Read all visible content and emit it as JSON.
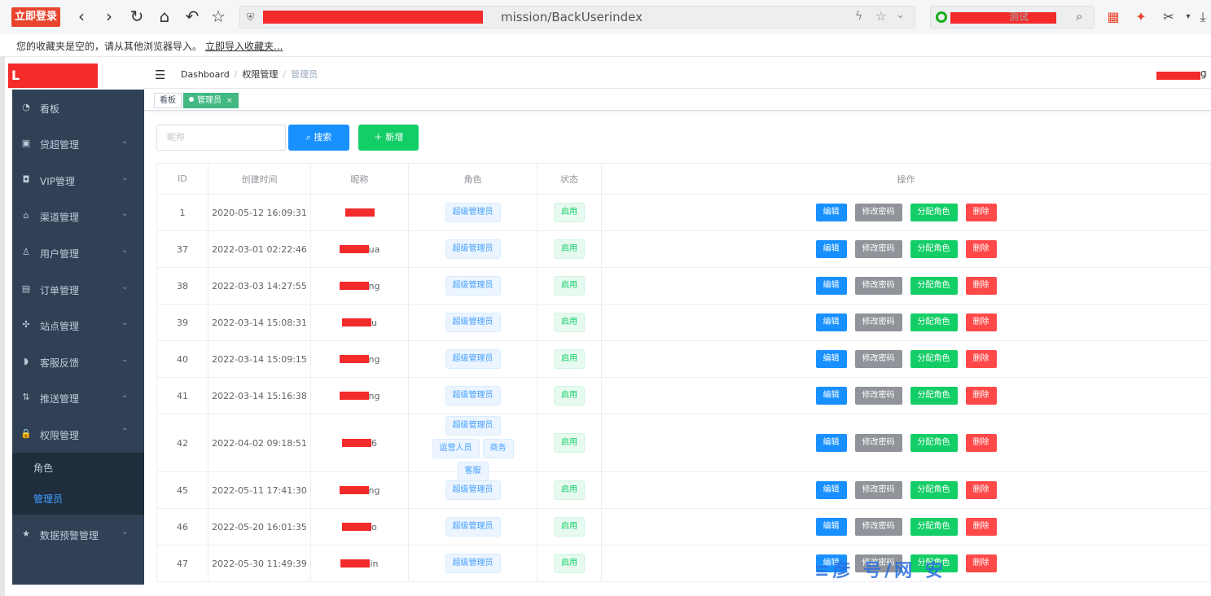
{
  "browser": {
    "login_label": "立即登录",
    "url_tail": "mission/BackUserindex",
    "search_tail": "测试",
    "fav_text": "您的收藏夹是空的，请从其他浏览器导入。",
    "fav_link": "立即导入收藏夹..."
  },
  "app": {
    "logo_text": "L",
    "breadcrumb": [
      "Dashboard",
      "权限管理",
      "管理员"
    ],
    "user_tail": "g"
  },
  "sidebar": {
    "items": [
      {
        "label": "看板",
        "icon": "dashboard-icon",
        "glyph": "◔"
      },
      {
        "label": "贷超管理",
        "icon": "wallet-icon",
        "glyph": "▣"
      },
      {
        "label": "VIP管理",
        "icon": "camera-icon",
        "glyph": "◘"
      },
      {
        "label": "渠道管理",
        "icon": "bell-icon",
        "glyph": "⌂"
      },
      {
        "label": "用户管理",
        "icon": "user-icon",
        "glyph": "♙"
      },
      {
        "label": "订单管理",
        "icon": "clipboard-icon",
        "glyph": "▤"
      },
      {
        "label": "站点管理",
        "icon": "site-icon",
        "glyph": "✣"
      },
      {
        "label": "客服反馈",
        "icon": "headset-icon",
        "glyph": "◗"
      },
      {
        "label": "推送管理",
        "icon": "sort-icon",
        "glyph": "⇅"
      },
      {
        "label": "权限管理",
        "icon": "lock-icon",
        "glyph": "🔒"
      }
    ],
    "sub_items": [
      "角色",
      "管理员"
    ],
    "last_item": {
      "label": "数据预警管理",
      "icon": "star-icon",
      "glyph": "★"
    }
  },
  "tags": [
    "看板",
    "管理员"
  ],
  "search": {
    "placeholder": "昵称",
    "search_label": "搜索",
    "add_label": "新增"
  },
  "table": {
    "headers": [
      "ID",
      "创建时间",
      "昵称",
      "角色",
      "状态",
      "操作"
    ],
    "rows": [
      {
        "id": "1",
        "time": "2020-05-12 16:09:31",
        "nick": "",
        "roles": [
          "超级管理员"
        ],
        "status": "启用"
      },
      {
        "id": "37",
        "time": "2022-03-01 02:22:46",
        "nick": "ua",
        "roles": [
          "超级管理员"
        ],
        "status": "启用"
      },
      {
        "id": "38",
        "time": "2022-03-03 14:27:55",
        "nick": "ng",
        "roles": [
          "超级管理员"
        ],
        "status": "启用"
      },
      {
        "id": "39",
        "time": "2022-03-14 15:08:31",
        "nick": "u",
        "roles": [
          "超级管理员"
        ],
        "status": "启用"
      },
      {
        "id": "40",
        "time": "2022-03-14 15:09:15",
        "nick": "ng",
        "roles": [
          "超级管理员"
        ],
        "status": "启用"
      },
      {
        "id": "41",
        "time": "2022-03-14 15:16:38",
        "nick": "ng",
        "roles": [
          "超级管理员"
        ],
        "status": "启用"
      },
      {
        "id": "42",
        "time": "2022-04-02 09:18:51",
        "nick": "6",
        "roles": [
          "超级管理员",
          "运营人员",
          "商务",
          "客服"
        ],
        "status": "启用"
      },
      {
        "id": "45",
        "time": "2022-05-11 17:41:30",
        "nick": "ng",
        "roles": [
          "超级管理员"
        ],
        "status": "启用"
      },
      {
        "id": "46",
        "time": "2022-05-20 16:01:35",
        "nick": "o",
        "roles": [
          "超级管理员"
        ],
        "status": "启用"
      },
      {
        "id": "47",
        "time": "2022-05-30 11:49:39",
        "nick": "in",
        "roles": [
          "超级管理员"
        ],
        "status": "启用"
      }
    ],
    "ops": [
      "编辑",
      "修改密码",
      "分配角色",
      "删除"
    ]
  },
  "watermark": "≡彦 号/网 安"
}
